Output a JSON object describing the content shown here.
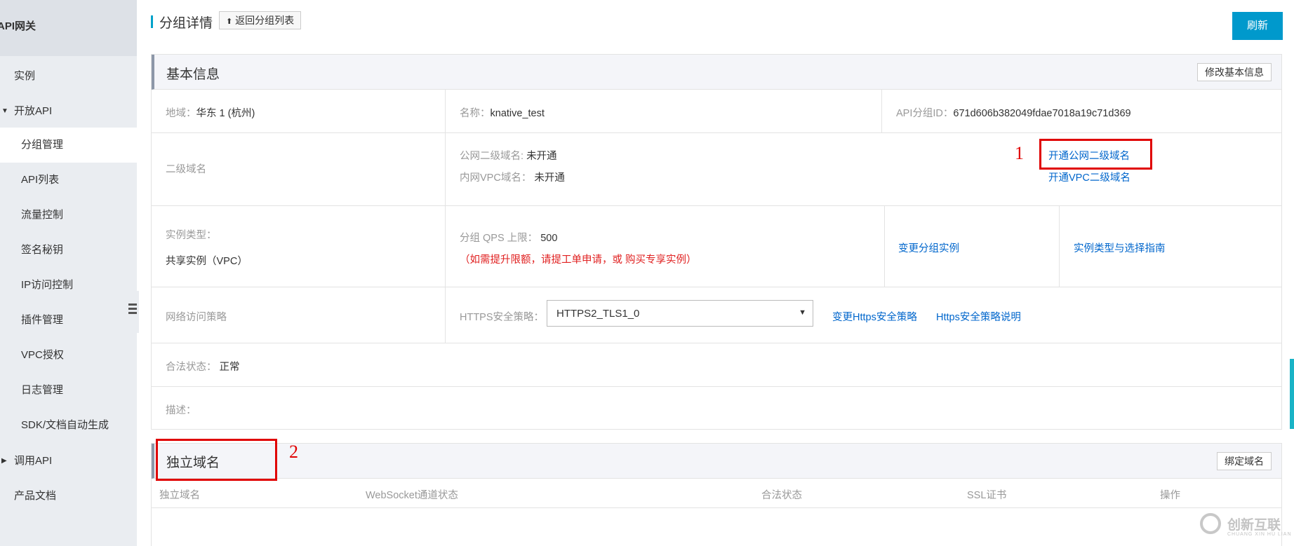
{
  "sidebar": {
    "title": "API网关",
    "items": [
      {
        "label": "实例"
      },
      {
        "label": "开放API"
      },
      {
        "label": "分组管理"
      },
      {
        "label": "API列表"
      },
      {
        "label": "流量控制"
      },
      {
        "label": "签名秘钥"
      },
      {
        "label": "IP访问控制"
      },
      {
        "label": "插件管理"
      },
      {
        "label": "VPC授权"
      },
      {
        "label": "日志管理"
      },
      {
        "label": "SDK/文档自动生成"
      },
      {
        "label": "调用API"
      },
      {
        "label": "产品文档"
      }
    ]
  },
  "header": {
    "title": "分组详情",
    "back_label": "返回分组列表",
    "refresh_label": "刷新"
  },
  "basic_info": {
    "title": "基本信息",
    "edit_label": "修改基本信息",
    "region_label": "地域：",
    "region_value": "华东 1 (杭州)",
    "name_label": "名称：",
    "name_value": "knative_test",
    "group_id_label": "API分组ID：",
    "group_id_value": "671d606b382049fdae7018a19c71d369",
    "subdomain_label": "二级域名",
    "public_subdomain_label": "公网二级域名:",
    "public_subdomain_value": "未开通",
    "vpc_domain_label": "内网VPC域名：",
    "vpc_domain_value": "未开通",
    "enable_public_link": "开通公网二级域名",
    "enable_vpc_link": "开通VPC二级域名",
    "instance_type_label": "实例类型：",
    "instance_type_value": "共享实例（VPC）",
    "qps_label": "分组 QPS 上限：",
    "qps_value": "500",
    "qps_note": "（如需提升限额，请提工单申请，或 购买专享实例）",
    "change_instance_link": "变更分组实例",
    "instance_guide_link": "实例类型与选择指南",
    "network_policy_label": "网络访问策略",
    "https_policy_label": "HTTPS安全策略：",
    "https_policy_value": "HTTPS2_TLS1_0",
    "change_https_link": "变更Https安全策略",
    "https_doc_link": "Https安全策略说明",
    "legal_status_label": "合法状态：",
    "legal_status_value": "正常",
    "description_label": "描述："
  },
  "custom_domain": {
    "title": "独立域名",
    "bind_label": "绑定域名",
    "columns": [
      "独立域名",
      "WebSocket通道状态",
      "合法状态",
      "SSL证书",
      "操作"
    ]
  },
  "annotations": [
    "1",
    "2"
  ],
  "watermark": {
    "text": "创新互联",
    "sub": "CHUANG XIN HU LIAN"
  },
  "colors": {
    "accent": "#0099cc",
    "link": "#0066cc",
    "annotation": "#e00000",
    "sidebar_bg": "#eaedf1"
  }
}
